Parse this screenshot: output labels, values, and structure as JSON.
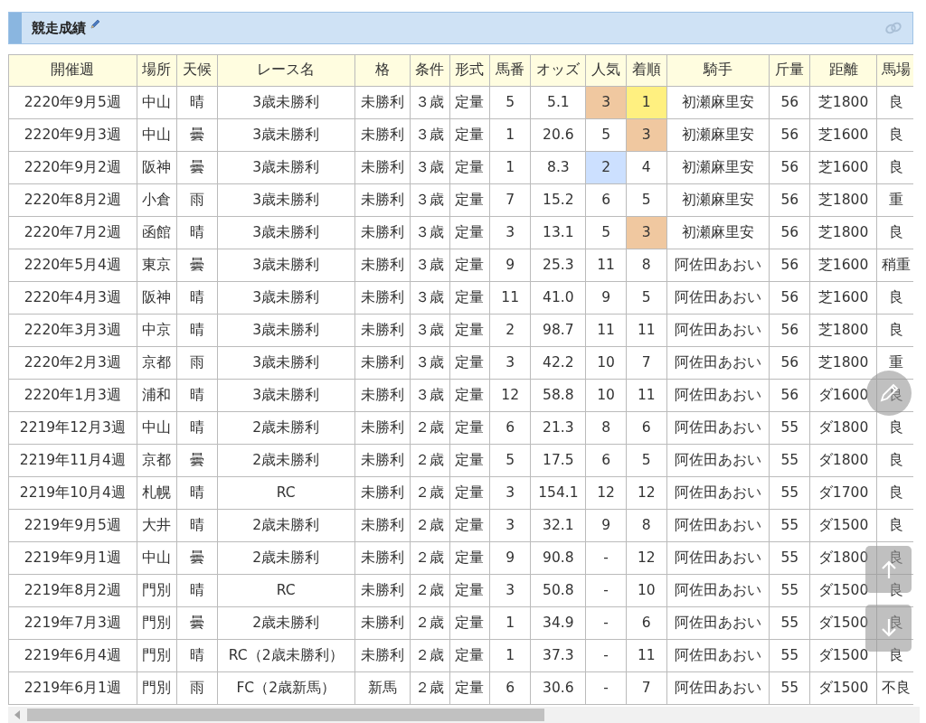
{
  "section": {
    "title": "競走成績"
  },
  "table": {
    "columns": [
      "開催週",
      "場所",
      "天候",
      "レース名",
      "格",
      "条件",
      "形式",
      "馬番",
      "オッズ",
      "人気",
      "着順",
      "騎手",
      "斤量",
      "距離",
      "馬場"
    ],
    "rows": [
      {
        "week": "2220年9月5週",
        "venue": "中山",
        "weather": "晴",
        "race": "3歳未勝利",
        "grade": "未勝利",
        "condition": "３歳",
        "format": "定量",
        "horse_no": "5",
        "odds": "5.1",
        "popularity": {
          "text": "3",
          "color": "#f0c8a0"
        },
        "finish": {
          "text": "1",
          "color": "#fff080"
        },
        "jockey": "初瀬麻里安",
        "weight": "56",
        "distance": "芝1800",
        "track": "良"
      },
      {
        "week": "2220年9月3週",
        "venue": "中山",
        "weather": "曇",
        "race": "3歳未勝利",
        "grade": "未勝利",
        "condition": "３歳",
        "format": "定量",
        "horse_no": "1",
        "odds": "20.6",
        "popularity": {
          "text": "5"
        },
        "finish": {
          "text": "3",
          "color": "#f0c8a0"
        },
        "jockey": "初瀬麻里安",
        "weight": "56",
        "distance": "芝1600",
        "track": "良"
      },
      {
        "week": "2220年9月2週",
        "venue": "阪神",
        "weather": "曇",
        "race": "3歳未勝利",
        "grade": "未勝利",
        "condition": "３歳",
        "format": "定量",
        "horse_no": "1",
        "odds": "8.3",
        "popularity": {
          "text": "2",
          "color": "#cce0ff"
        },
        "finish": {
          "text": "4"
        },
        "jockey": "初瀬麻里安",
        "weight": "56",
        "distance": "芝1600",
        "track": "良"
      },
      {
        "week": "2220年8月2週",
        "venue": "小倉",
        "weather": "雨",
        "race": "3歳未勝利",
        "grade": "未勝利",
        "condition": "３歳",
        "format": "定量",
        "horse_no": "7",
        "odds": "15.2",
        "popularity": {
          "text": "6"
        },
        "finish": {
          "text": "5"
        },
        "jockey": "初瀬麻里安",
        "weight": "56",
        "distance": "芝1800",
        "track": "重"
      },
      {
        "week": "2220年7月2週",
        "venue": "函館",
        "weather": "晴",
        "race": "3歳未勝利",
        "grade": "未勝利",
        "condition": "３歳",
        "format": "定量",
        "horse_no": "3",
        "odds": "13.1",
        "popularity": {
          "text": "5"
        },
        "finish": {
          "text": "3",
          "color": "#f0c8a0"
        },
        "jockey": "初瀬麻里安",
        "weight": "56",
        "distance": "芝1800",
        "track": "良"
      },
      {
        "week": "2220年5月4週",
        "venue": "東京",
        "weather": "曇",
        "race": "3歳未勝利",
        "grade": "未勝利",
        "condition": "３歳",
        "format": "定量",
        "horse_no": "9",
        "odds": "25.3",
        "popularity": {
          "text": "11"
        },
        "finish": {
          "text": "8"
        },
        "jockey": "阿佐田あおい",
        "weight": "56",
        "distance": "芝1600",
        "track": "稍重"
      },
      {
        "week": "2220年4月3週",
        "venue": "阪神",
        "weather": "晴",
        "race": "3歳未勝利",
        "grade": "未勝利",
        "condition": "３歳",
        "format": "定量",
        "horse_no": "11",
        "odds": "41.0",
        "popularity": {
          "text": "9"
        },
        "finish": {
          "text": "5"
        },
        "jockey": "阿佐田あおい",
        "weight": "56",
        "distance": "芝1600",
        "track": "良"
      },
      {
        "week": "2220年3月3週",
        "venue": "中京",
        "weather": "晴",
        "race": "3歳未勝利",
        "grade": "未勝利",
        "condition": "３歳",
        "format": "定量",
        "horse_no": "2",
        "odds": "98.7",
        "popularity": {
          "text": "11"
        },
        "finish": {
          "text": "11"
        },
        "jockey": "阿佐田あおい",
        "weight": "56",
        "distance": "芝1800",
        "track": "良"
      },
      {
        "week": "2220年2月3週",
        "venue": "京都",
        "weather": "雨",
        "race": "3歳未勝利",
        "grade": "未勝利",
        "condition": "３歳",
        "format": "定量",
        "horse_no": "3",
        "odds": "42.2",
        "popularity": {
          "text": "10"
        },
        "finish": {
          "text": "7"
        },
        "jockey": "阿佐田あおい",
        "weight": "56",
        "distance": "芝1800",
        "track": "重"
      },
      {
        "week": "2220年1月3週",
        "venue": "浦和",
        "weather": "晴",
        "race": "3歳未勝利",
        "grade": "未勝利",
        "condition": "３歳",
        "format": "定量",
        "horse_no": "12",
        "odds": "58.8",
        "popularity": {
          "text": "10"
        },
        "finish": {
          "text": "11"
        },
        "jockey": "阿佐田あおい",
        "weight": "56",
        "distance": "ダ1600",
        "track": "良"
      },
      {
        "week": "2219年12月3週",
        "venue": "中山",
        "weather": "晴",
        "race": "2歳未勝利",
        "grade": "未勝利",
        "condition": "２歳",
        "format": "定量",
        "horse_no": "6",
        "odds": "21.3",
        "popularity": {
          "text": "8"
        },
        "finish": {
          "text": "6"
        },
        "jockey": "阿佐田あおい",
        "weight": "55",
        "distance": "ダ1800",
        "track": "良"
      },
      {
        "week": "2219年11月4週",
        "venue": "京都",
        "weather": "曇",
        "race": "2歳未勝利",
        "grade": "未勝利",
        "condition": "２歳",
        "format": "定量",
        "horse_no": "5",
        "odds": "17.5",
        "popularity": {
          "text": "6"
        },
        "finish": {
          "text": "5"
        },
        "jockey": "阿佐田あおい",
        "weight": "55",
        "distance": "ダ1800",
        "track": "良"
      },
      {
        "week": "2219年10月4週",
        "venue": "札幌",
        "weather": "晴",
        "race": "RC",
        "grade": "未勝利",
        "condition": "２歳",
        "format": "定量",
        "horse_no": "3",
        "odds": "154.1",
        "popularity": {
          "text": "12"
        },
        "finish": {
          "text": "12"
        },
        "jockey": "阿佐田あおい",
        "weight": "55",
        "distance": "ダ1700",
        "track": "良"
      },
      {
        "week": "2219年9月5週",
        "venue": "大井",
        "weather": "晴",
        "race": "2歳未勝利",
        "grade": "未勝利",
        "condition": "２歳",
        "format": "定量",
        "horse_no": "3",
        "odds": "32.1",
        "popularity": {
          "text": "9"
        },
        "finish": {
          "text": "8"
        },
        "jockey": "阿佐田あおい",
        "weight": "55",
        "distance": "ダ1500",
        "track": "良"
      },
      {
        "week": "2219年9月1週",
        "venue": "中山",
        "weather": "曇",
        "race": "2歳未勝利",
        "grade": "未勝利",
        "condition": "２歳",
        "format": "定量",
        "horse_no": "9",
        "odds": "90.8",
        "popularity": {
          "text": "-"
        },
        "finish": {
          "text": "12"
        },
        "jockey": "阿佐田あおい",
        "weight": "55",
        "distance": "ダ1800",
        "track": "良"
      },
      {
        "week": "2219年8月2週",
        "venue": "門別",
        "weather": "晴",
        "race": "RC",
        "grade": "未勝利",
        "condition": "２歳",
        "format": "定量",
        "horse_no": "3",
        "odds": "50.8",
        "popularity": {
          "text": "-"
        },
        "finish": {
          "text": "10"
        },
        "jockey": "阿佐田あおい",
        "weight": "55",
        "distance": "ダ1500",
        "track": "良"
      },
      {
        "week": "2219年7月3週",
        "venue": "門別",
        "weather": "曇",
        "race": "2歳未勝利",
        "grade": "未勝利",
        "condition": "２歳",
        "format": "定量",
        "horse_no": "1",
        "odds": "34.9",
        "popularity": {
          "text": "-"
        },
        "finish": {
          "text": "6"
        },
        "jockey": "阿佐田あおい",
        "weight": "55",
        "distance": "ダ1500",
        "track": "良"
      },
      {
        "week": "2219年6月4週",
        "venue": "門別",
        "weather": "晴",
        "race": "RC（2歳未勝利）",
        "grade": "未勝利",
        "condition": "２歳",
        "format": "定量",
        "horse_no": "1",
        "odds": "37.3",
        "popularity": {
          "text": "-"
        },
        "finish": {
          "text": "11"
        },
        "jockey": "阿佐田あおい",
        "weight": "55",
        "distance": "ダ1500",
        "track": "良"
      },
      {
        "week": "2219年6月1週",
        "venue": "門別",
        "weather": "雨",
        "race": "FC（2歳新馬）",
        "grade": "新馬",
        "condition": "２歳",
        "format": "定量",
        "horse_no": "6",
        "odds": "30.6",
        "popularity": {
          "text": "-"
        },
        "finish": {
          "text": "7"
        },
        "jockey": "阿佐田あおい",
        "weight": "55",
        "distance": "ダ1500",
        "track": "不良"
      }
    ]
  }
}
